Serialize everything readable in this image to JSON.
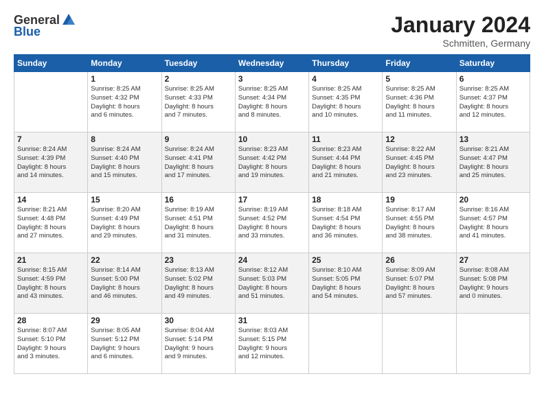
{
  "logo": {
    "general": "General",
    "blue": "Blue"
  },
  "title": "January 2024",
  "location": "Schmitten, Germany",
  "days_of_week": [
    "Sunday",
    "Monday",
    "Tuesday",
    "Wednesday",
    "Thursday",
    "Friday",
    "Saturday"
  ],
  "weeks": [
    [
      {
        "day": "",
        "info": ""
      },
      {
        "day": "1",
        "info": "Sunrise: 8:25 AM\nSunset: 4:32 PM\nDaylight: 8 hours\nand 6 minutes."
      },
      {
        "day": "2",
        "info": "Sunrise: 8:25 AM\nSunset: 4:33 PM\nDaylight: 8 hours\nand 7 minutes."
      },
      {
        "day": "3",
        "info": "Sunrise: 8:25 AM\nSunset: 4:34 PM\nDaylight: 8 hours\nand 8 minutes."
      },
      {
        "day": "4",
        "info": "Sunrise: 8:25 AM\nSunset: 4:35 PM\nDaylight: 8 hours\nand 10 minutes."
      },
      {
        "day": "5",
        "info": "Sunrise: 8:25 AM\nSunset: 4:36 PM\nDaylight: 8 hours\nand 11 minutes."
      },
      {
        "day": "6",
        "info": "Sunrise: 8:25 AM\nSunset: 4:37 PM\nDaylight: 8 hours\nand 12 minutes."
      }
    ],
    [
      {
        "day": "7",
        "info": "Sunrise: 8:24 AM\nSunset: 4:39 PM\nDaylight: 8 hours\nand 14 minutes."
      },
      {
        "day": "8",
        "info": "Sunrise: 8:24 AM\nSunset: 4:40 PM\nDaylight: 8 hours\nand 15 minutes."
      },
      {
        "day": "9",
        "info": "Sunrise: 8:24 AM\nSunset: 4:41 PM\nDaylight: 8 hours\nand 17 minutes."
      },
      {
        "day": "10",
        "info": "Sunrise: 8:23 AM\nSunset: 4:42 PM\nDaylight: 8 hours\nand 19 minutes."
      },
      {
        "day": "11",
        "info": "Sunrise: 8:23 AM\nSunset: 4:44 PM\nDaylight: 8 hours\nand 21 minutes."
      },
      {
        "day": "12",
        "info": "Sunrise: 8:22 AM\nSunset: 4:45 PM\nDaylight: 8 hours\nand 23 minutes."
      },
      {
        "day": "13",
        "info": "Sunrise: 8:21 AM\nSunset: 4:47 PM\nDaylight: 8 hours\nand 25 minutes."
      }
    ],
    [
      {
        "day": "14",
        "info": "Sunrise: 8:21 AM\nSunset: 4:48 PM\nDaylight: 8 hours\nand 27 minutes."
      },
      {
        "day": "15",
        "info": "Sunrise: 8:20 AM\nSunset: 4:49 PM\nDaylight: 8 hours\nand 29 minutes."
      },
      {
        "day": "16",
        "info": "Sunrise: 8:19 AM\nSunset: 4:51 PM\nDaylight: 8 hours\nand 31 minutes."
      },
      {
        "day": "17",
        "info": "Sunrise: 8:19 AM\nSunset: 4:52 PM\nDaylight: 8 hours\nand 33 minutes."
      },
      {
        "day": "18",
        "info": "Sunrise: 8:18 AM\nSunset: 4:54 PM\nDaylight: 8 hours\nand 36 minutes."
      },
      {
        "day": "19",
        "info": "Sunrise: 8:17 AM\nSunset: 4:55 PM\nDaylight: 8 hours\nand 38 minutes."
      },
      {
        "day": "20",
        "info": "Sunrise: 8:16 AM\nSunset: 4:57 PM\nDaylight: 8 hours\nand 41 minutes."
      }
    ],
    [
      {
        "day": "21",
        "info": "Sunrise: 8:15 AM\nSunset: 4:59 PM\nDaylight: 8 hours\nand 43 minutes."
      },
      {
        "day": "22",
        "info": "Sunrise: 8:14 AM\nSunset: 5:00 PM\nDaylight: 8 hours\nand 46 minutes."
      },
      {
        "day": "23",
        "info": "Sunrise: 8:13 AM\nSunset: 5:02 PM\nDaylight: 8 hours\nand 49 minutes."
      },
      {
        "day": "24",
        "info": "Sunrise: 8:12 AM\nSunset: 5:03 PM\nDaylight: 8 hours\nand 51 minutes."
      },
      {
        "day": "25",
        "info": "Sunrise: 8:10 AM\nSunset: 5:05 PM\nDaylight: 8 hours\nand 54 minutes."
      },
      {
        "day": "26",
        "info": "Sunrise: 8:09 AM\nSunset: 5:07 PM\nDaylight: 8 hours\nand 57 minutes."
      },
      {
        "day": "27",
        "info": "Sunrise: 8:08 AM\nSunset: 5:08 PM\nDaylight: 9 hours\nand 0 minutes."
      }
    ],
    [
      {
        "day": "28",
        "info": "Sunrise: 8:07 AM\nSunset: 5:10 PM\nDaylight: 9 hours\nand 3 minutes."
      },
      {
        "day": "29",
        "info": "Sunrise: 8:05 AM\nSunset: 5:12 PM\nDaylight: 9 hours\nand 6 minutes."
      },
      {
        "day": "30",
        "info": "Sunrise: 8:04 AM\nSunset: 5:14 PM\nDaylight: 9 hours\nand 9 minutes."
      },
      {
        "day": "31",
        "info": "Sunrise: 8:03 AM\nSunset: 5:15 PM\nDaylight: 9 hours\nand 12 minutes."
      },
      {
        "day": "",
        "info": ""
      },
      {
        "day": "",
        "info": ""
      },
      {
        "day": "",
        "info": ""
      }
    ]
  ]
}
